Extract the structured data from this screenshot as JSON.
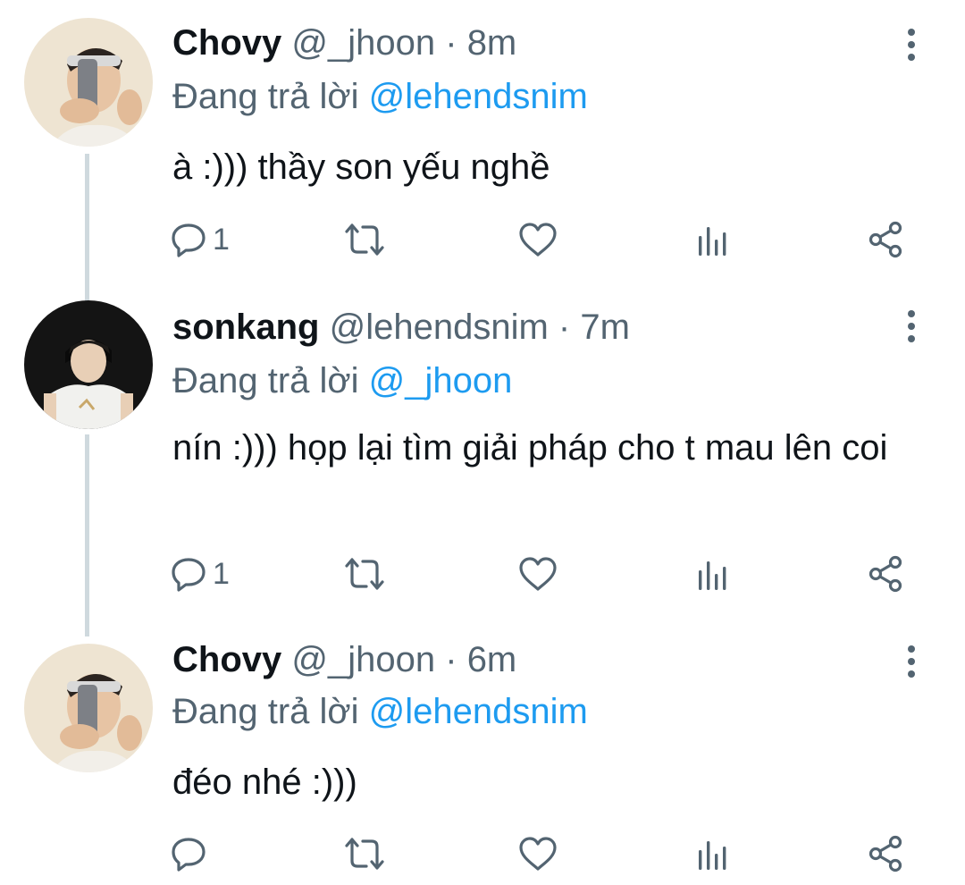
{
  "tweets": [
    {
      "name": "Chovy",
      "handle": "@_jhoon",
      "separator": "·",
      "time": "8m",
      "reply_prefix": "Đang trả lời",
      "reply_to": "@lehendsnim",
      "text": "à :))) thầy son yếu nghề",
      "reply_count": "1"
    },
    {
      "name": "sonkang",
      "handle": "@lehendsnim",
      "separator": "·",
      "time": "7m",
      "reply_prefix": "Đang trả lời",
      "reply_to": "@_jhoon",
      "text": "nín :))) họp lại tìm giải pháp cho t mau lên coi",
      "reply_count": "1"
    },
    {
      "name": "Chovy",
      "handle": "@_jhoon",
      "separator": "·",
      "time": "6m",
      "reply_prefix": "Đang trả lời",
      "reply_to": "@lehendsnim",
      "text": "đéo nhé :)))",
      "reply_count": ""
    }
  ],
  "icons": {
    "reply": "reply-icon",
    "retweet": "retweet-icon",
    "like": "heart-icon",
    "stats": "stats-icon",
    "share": "share-icon",
    "menu": "more-vertical-icon"
  },
  "colors": {
    "text": "#0f1419",
    "secondary": "#536471",
    "mention": "#1d9bf0",
    "thread_line": "#cfd9de"
  }
}
